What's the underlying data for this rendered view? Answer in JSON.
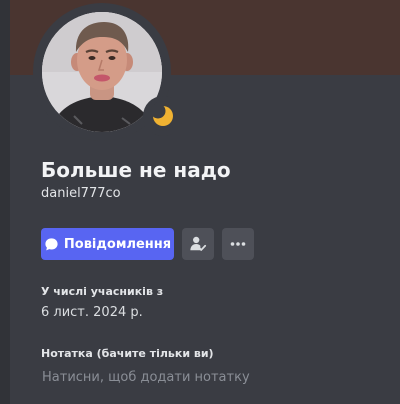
{
  "profile": {
    "display_name": "Больше не надо",
    "username": "daniel777co",
    "banner_color": "#4a3530",
    "status": "idle",
    "status_icon": "moon-icon",
    "avatar": "profile-photo"
  },
  "actions": {
    "message_label": "Повідомлення",
    "message_icon": "chat-bubble-icon",
    "friend_icon": "friend-request-pending-icon",
    "more_icon": "more-dots-icon"
  },
  "member_since": {
    "label": "У числі учасників з",
    "date": "6 лист. 2024 р."
  },
  "note": {
    "label": "Нотатка (бачите тільки ви)",
    "placeholder": "Натисни, щоб додати нотатку",
    "value": ""
  },
  "colors": {
    "accent": "#5865f2",
    "idle_status": "#f0b232",
    "card_background": "#3a3c43"
  }
}
